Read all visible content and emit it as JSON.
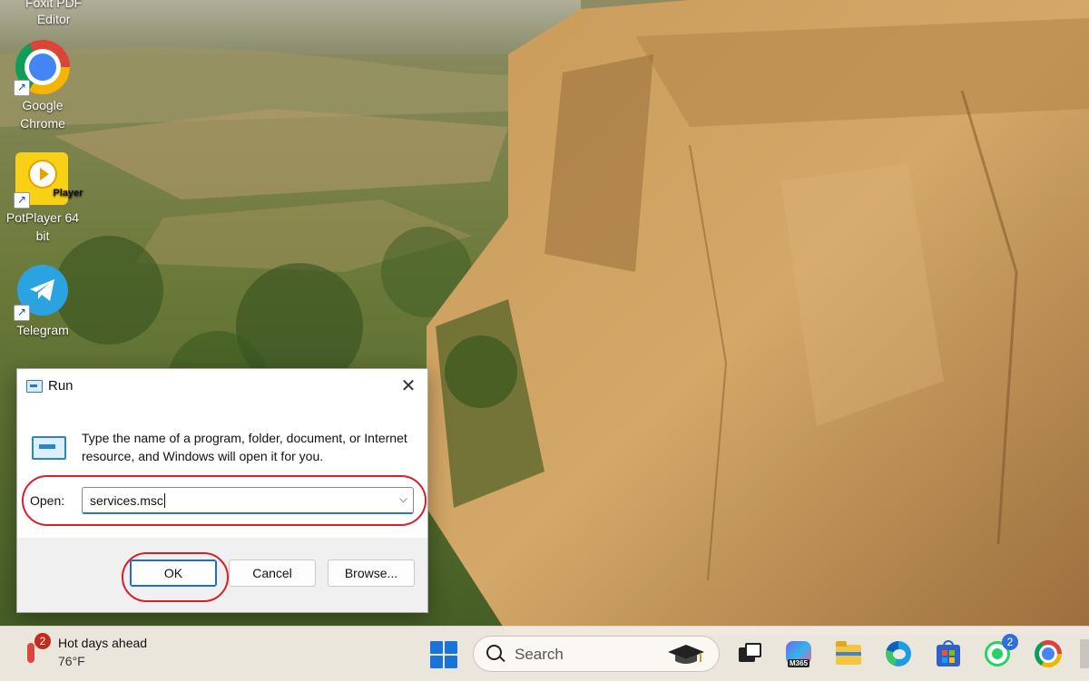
{
  "desktop": {
    "top_partial_label": "Foxit PDF\nEditor",
    "icons": [
      {
        "label": "Google\nChrome",
        "icon": "chrome-icon"
      },
      {
        "label": "PotPlayer 64\nbit",
        "icon": "potplayer-icon",
        "logo_text": "Player"
      },
      {
        "label": "Telegram",
        "icon": "telegram-icon"
      }
    ]
  },
  "run_dialog": {
    "title": "Run",
    "description": "Type the name of a program, folder, document, or Internet resource, and Windows will open it for you.",
    "open_label": "Open:",
    "open_value": "services.msc",
    "buttons": {
      "ok": "OK",
      "cancel": "Cancel",
      "browse": "Browse..."
    },
    "highlight_color": "#d91e2a"
  },
  "taskbar": {
    "weather": {
      "title": "Hot days ahead",
      "temp": "76°F",
      "badge": "2"
    },
    "search_placeholder": "Search",
    "apps": [
      {
        "name": "task-view-icon"
      },
      {
        "name": "m365-icon",
        "label": "M365"
      },
      {
        "name": "file-explorer-icon"
      },
      {
        "name": "edge-icon"
      },
      {
        "name": "microsoft-store-icon"
      },
      {
        "name": "whatsapp-icon",
        "badge": "2"
      },
      {
        "name": "chrome-taskbar-icon"
      }
    ]
  }
}
